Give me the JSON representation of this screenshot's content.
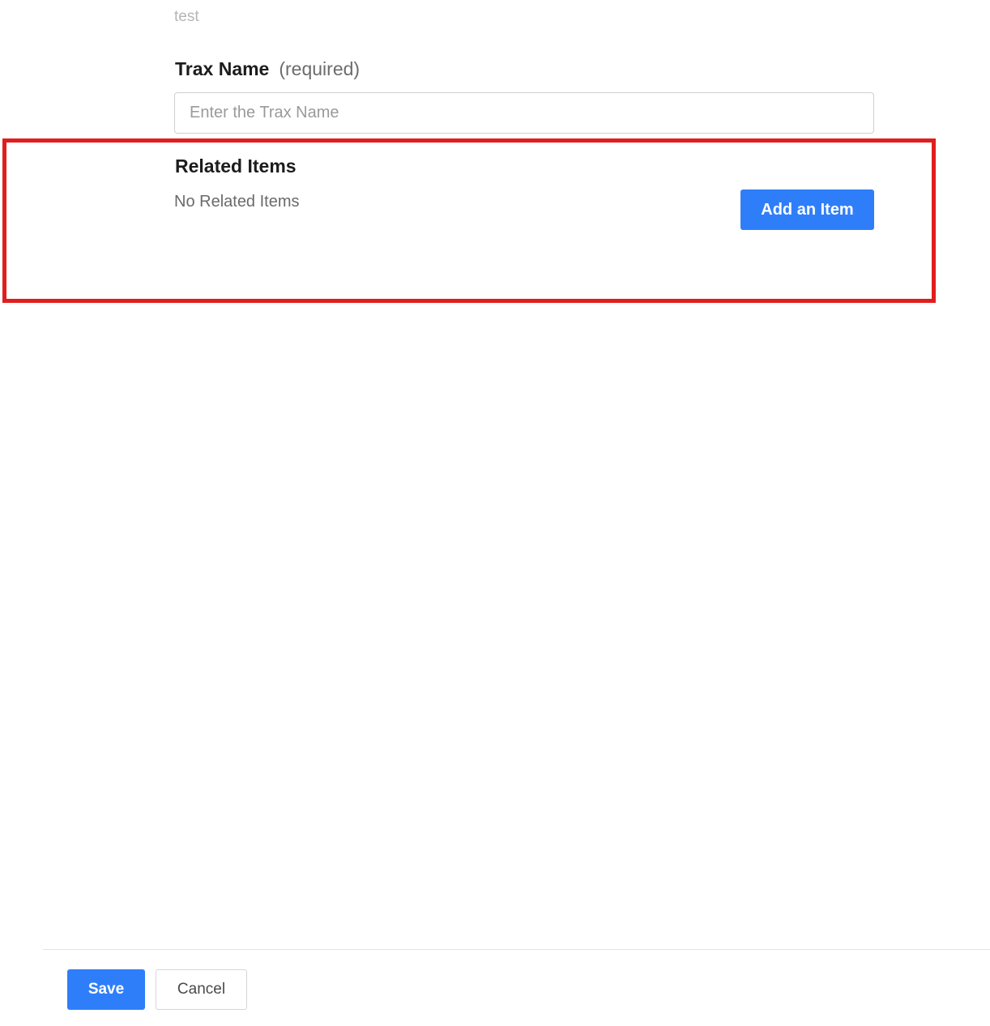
{
  "top_value": "test",
  "trax_name_field": {
    "label": "Trax Name",
    "required_note": "(required)",
    "placeholder": "Enter the Trax Name",
    "value": ""
  },
  "related_items": {
    "title": "Related Items",
    "empty_text": "No Related Items",
    "add_button_label": "Add an Item"
  },
  "footer": {
    "save_label": "Save",
    "cancel_label": "Cancel"
  },
  "colors": {
    "primary_button": "#2f7ef9",
    "highlight_outline": "#e01e1e"
  }
}
